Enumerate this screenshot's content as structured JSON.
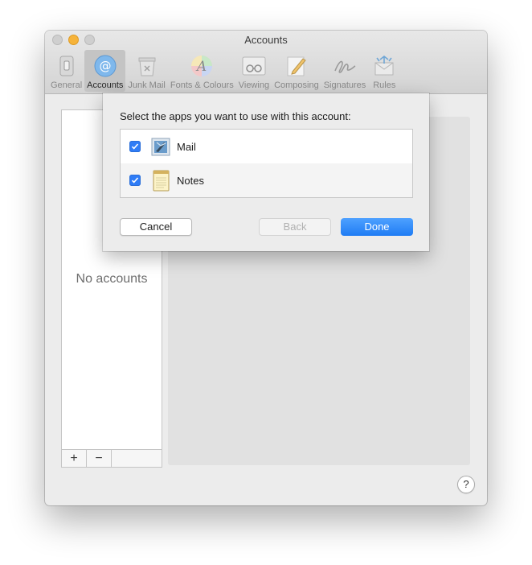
{
  "window": {
    "title": "Accounts"
  },
  "toolbar": {
    "items": [
      {
        "label": "General",
        "icon": "general-switch-icon"
      },
      {
        "label": "Accounts",
        "icon": "at-sign-icon",
        "selected": true
      },
      {
        "label": "Junk Mail",
        "icon": "junk-bin-icon"
      },
      {
        "label": "Fonts & Colours",
        "icon": "fonts-colours-icon"
      },
      {
        "label": "Viewing",
        "icon": "viewing-glasses-icon"
      },
      {
        "label": "Composing",
        "icon": "composing-pencil-icon"
      },
      {
        "label": "Signatures",
        "icon": "signature-icon"
      },
      {
        "label": "Rules",
        "icon": "rules-envelope-icon"
      }
    ]
  },
  "accounts_list": {
    "empty_text": "No accounts",
    "add_label": "+",
    "remove_label": "−"
  },
  "sheet": {
    "prompt": "Select the apps you want to use with this account:",
    "apps": [
      {
        "name": "Mail",
        "checked": true,
        "icon": "mail-app-icon"
      },
      {
        "name": "Notes",
        "checked": true,
        "icon": "notes-app-icon"
      }
    ],
    "cancel_label": "Cancel",
    "back_label": "Back",
    "done_label": "Done"
  },
  "help": {
    "label": "?"
  },
  "colors": {
    "accent": "#1f7cf4",
    "checkbox": "#2f7cf6"
  }
}
